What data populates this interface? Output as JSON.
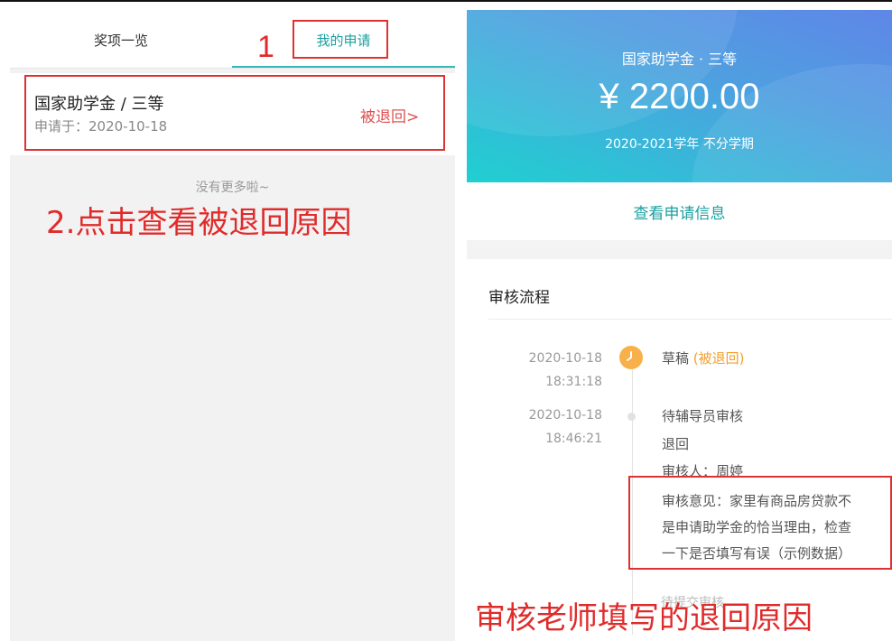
{
  "left": {
    "tabs": [
      {
        "label": "奖项一览"
      },
      {
        "label": "我的申请"
      }
    ],
    "annotation_step1": "1",
    "application": {
      "title": "国家助学金 / 三等",
      "date": "申请于：2020-10-18",
      "status": "被退回>"
    },
    "no_more": "没有更多啦~",
    "annotation_step2": "2.点击查看被退回原因"
  },
  "right": {
    "hero": {
      "title": "国家助学金 · 三等",
      "amount": "¥ 2200.00",
      "term": "2020-2021学年 不分学期"
    },
    "view_info": "查看申请信息",
    "flow": {
      "heading": "审核流程",
      "steps": [
        {
          "date": "2020-10-18",
          "time": "18:31:18",
          "title": "草稿",
          "tag": "(被退回)"
        },
        {
          "date": "2020-10-18",
          "time": "18:46:21",
          "title": "待辅导员审核",
          "result": "退回",
          "reviewer": "审核人：周婷",
          "opinion_lines": [
            "审核意见：家里有商品房贷款不",
            "是申请助学金的恰当理由，检查",
            "一下是否填写有误（示例数据）"
          ]
        }
      ],
      "faded_text": "待提交审核"
    },
    "annotation_caption": "审核老师填写的退回原因"
  },
  "colors": {
    "accent": "#1aa0a0",
    "annotation_red": "#e02b2b",
    "status_orange": "#f0a030"
  },
  "icons": [
    "clock-icon",
    "timeline-dot-icon"
  ]
}
